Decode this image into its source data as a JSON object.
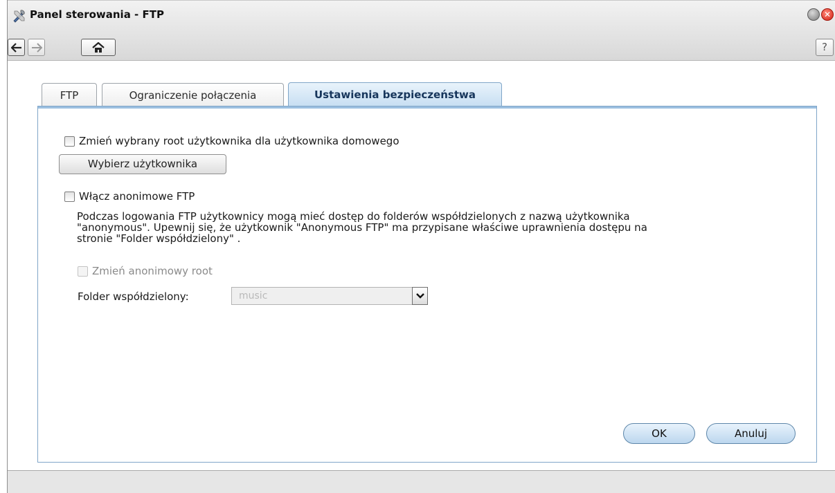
{
  "window": {
    "title": "Panel sterowania - FTP",
    "app_icon": "tools-icon",
    "close_glyph": "✕"
  },
  "toolbar": {
    "back_icon": "arrow-left-icon",
    "forward_icon": "arrow-right-icon",
    "home_icon": "home-icon",
    "help_label": "?"
  },
  "tabs": [
    {
      "label": "FTP",
      "active": false
    },
    {
      "label": "Ograniczenie połączenia",
      "active": false
    },
    {
      "label": "Ustawienia bezpieczeństwa",
      "active": true
    }
  ],
  "security": {
    "change_root_label": "Zmień wybrany root użytkownika dla użytkownika domowego",
    "change_root_checked": false,
    "select_user_button": "Wybierz użytkownika",
    "anonymous_label": "Włącz anonimowe FTP",
    "anonymous_checked": false,
    "anonymous_desc_lines": [
      "Podczas logowania FTP użytkownicy mogą mieć dostęp do folderów współdzielonych z nazwą użytkownika",
      "\"anonymous\". Upewnij się, że użytkownik \"Anonymous FTP\" ma przypisane właściwe uprawnienia dostępu na",
      "stronie \"Folder współdzielony\" ."
    ],
    "anon_root_label": "Zmień anonimowy root",
    "anon_root_checked": false,
    "shared_folder_label": "Folder współdzielony:",
    "shared_folder_value": "music"
  },
  "buttons": {
    "ok": "OK",
    "cancel": "Anuluj"
  },
  "colors": {
    "accent_blue": "#7fa5c8",
    "active_tab_text": "#17365c",
    "close_red": "#d21f13"
  }
}
